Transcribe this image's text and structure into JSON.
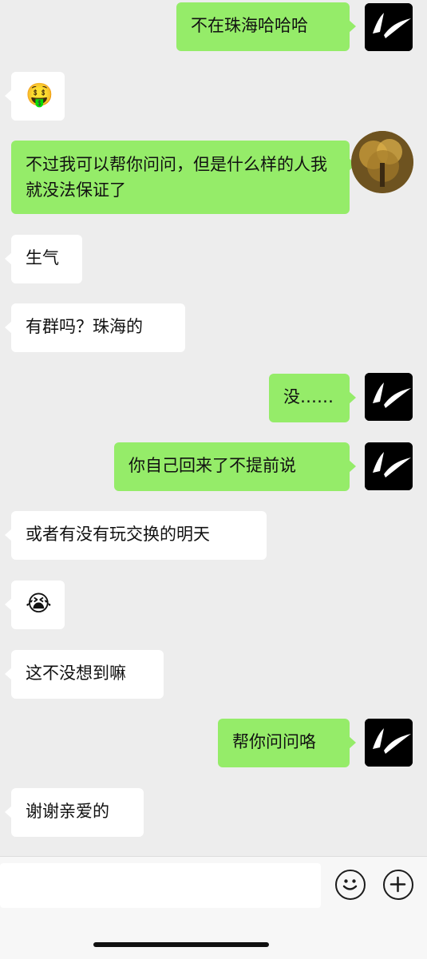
{
  "conversation": {
    "messages": [
      {
        "side": "right",
        "text": "不在珠海哈哈哈"
      },
      {
        "side": "left",
        "emoji": "🤑"
      },
      {
        "side": "right",
        "text": "不过我可以帮你问问，但是什么样的人我就没法保证了"
      },
      {
        "side": "left",
        "text": "生气"
      },
      {
        "side": "left",
        "text": "有群吗？珠海的"
      },
      {
        "side": "right",
        "text": "没……"
      },
      {
        "side": "right",
        "text": "你自己回来了不提前说"
      },
      {
        "side": "left",
        "text": "或者有没有玩交换的明天"
      },
      {
        "side": "left",
        "emoji": "😭"
      },
      {
        "side": "left",
        "text": "这不没想到嘛"
      },
      {
        "side": "right",
        "text": "帮你问问咯"
      },
      {
        "side": "left",
        "text": "谢谢亲爱的"
      }
    ]
  },
  "input_bar": {
    "draft": "",
    "emoji_icon": "smiley-face-icon",
    "more_icon": "plus-circle-icon"
  },
  "colors": {
    "background": "#ededed",
    "sent_bubble": "#95ec69",
    "received_bubble": "#ffffff"
  }
}
